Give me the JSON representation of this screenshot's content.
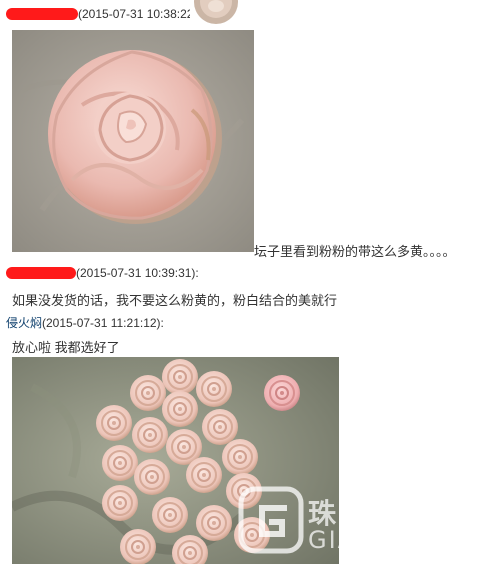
{
  "messages": [
    {
      "sender": "",
      "timestamp": "(2015-07-31 10:38:22):",
      "image_caption": "坛子里看到粉粉的带这么多黄。。。。"
    },
    {
      "sender": "",
      "timestamp": "(2015-07-31 10:39:31):",
      "text": "如果没发货的话，我不要这么粉黄的，粉白结合的美就行"
    },
    {
      "sender": "侵火焖",
      "timestamp": "(2015-07-31 11:21:12):",
      "text": "放心啦  我都选好了"
    }
  ],
  "watermark": {
    "cn": "珠宝大家坛",
    "en": "GIAhome.com"
  },
  "colors": {
    "redaction": "#ff1a1a",
    "sender_name": "#0b3d6b",
    "text": "#333333",
    "pink_carving": "#f2c6bf"
  }
}
